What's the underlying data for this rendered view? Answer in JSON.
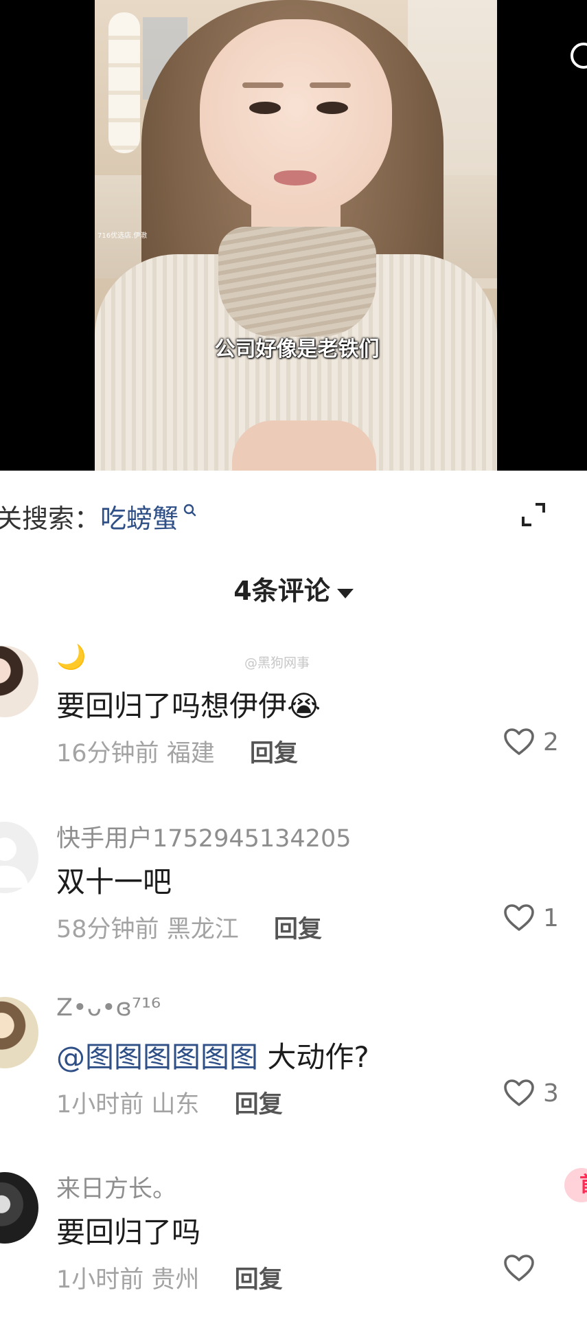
{
  "video": {
    "shop_watermark": "716优选店.伊澈",
    "subtitle": "公司好像是老铁们"
  },
  "related_search": {
    "label": "关搜索：",
    "term": "吃螃蟹"
  },
  "comments_header": {
    "title": "4条评论"
  },
  "watermark": "@黑狗网事",
  "comments": [
    {
      "username": "🌙",
      "content": "要回归了吗想伊伊😭",
      "time": "16分钟前",
      "location": "福建",
      "reply": "回复",
      "likes": "2"
    },
    {
      "username": "快手用户1752945134205",
      "content": "双十一吧",
      "time": "58分钟前",
      "location": "黑龙江",
      "reply": "回复",
      "likes": "1"
    },
    {
      "username": "Z•ᴗ•ɞ⁷¹⁶",
      "mention": "@图图图图图图",
      "content": " 大动作?",
      "time": "1小时前",
      "location": "山东",
      "reply": "回复",
      "likes": "3"
    },
    {
      "username": "来日方长。",
      "content": "要回归了吗",
      "time": "1小时前",
      "location": "贵州",
      "reply": "回复",
      "likes": ""
    }
  ],
  "pinned_badge": "首",
  "colors": {
    "link": "#2f4f87",
    "muted_text": "#a3a3a3",
    "pin": "#ff2c55"
  },
  "icons": [
    "search-icon",
    "expand-icon",
    "caret-down-icon",
    "heart-icon",
    "default-avatar-icon"
  ]
}
